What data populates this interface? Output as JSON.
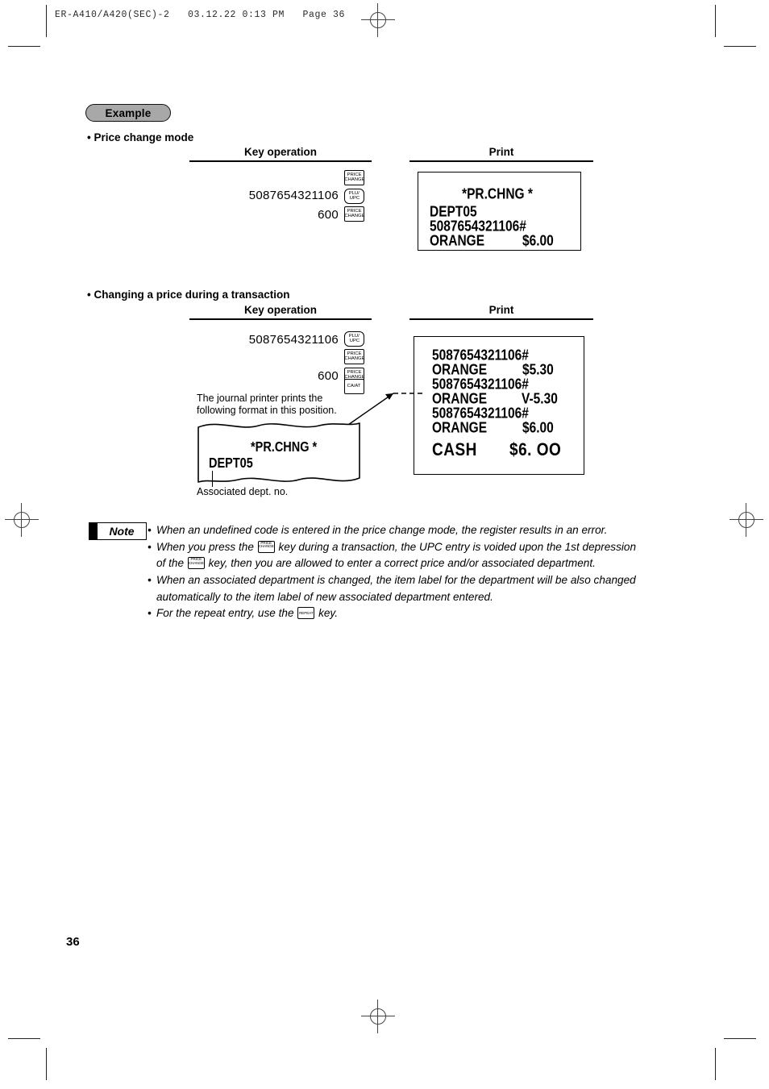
{
  "doc": {
    "header_line": "ER-A410/A420(SEC)-2   03.12.22 0:13 PM   Page 36",
    "page_number": "36"
  },
  "example": {
    "badge_label": "Example"
  },
  "sections": [
    {
      "heading": "• Price change mode",
      "key_operation_title": "Key operation",
      "print_title": "Print",
      "key_rows": [
        {
          "number": "",
          "keys": [
            {
              "lines": [
                "PRICE",
                "CHANGE"
              ],
              "shape": "square",
              "name": "price-change"
            }
          ]
        },
        {
          "number": "5087654321106",
          "keys": [
            {
              "lines": [
                "PLU/",
                "UPC"
              ],
              "shape": "round",
              "name": "plu-upc"
            }
          ]
        },
        {
          "number": "600",
          "keys": [
            {
              "lines": [
                "PRICE",
                "CHANGE"
              ],
              "shape": "square",
              "name": "price-change"
            }
          ]
        }
      ],
      "receipt": {
        "title": "*PR.CHNG *",
        "lines": [
          {
            "label": "DEPT05",
            "amount": ""
          },
          {
            "label": "5087654321106#",
            "amount": ""
          },
          {
            "label": "ORANGE",
            "amount": "$6.00"
          }
        ]
      }
    },
    {
      "heading": "• Changing a price during a transaction",
      "key_operation_title": "Key operation",
      "print_title": "Print",
      "key_rows": [
        {
          "number": "5087654321106",
          "keys": [
            {
              "lines": [
                "PLU/",
                "UPC"
              ],
              "shape": "round",
              "name": "plu-upc"
            }
          ]
        },
        {
          "number": "",
          "keys": [
            {
              "lines": [
                "PRICE",
                "CHANGE"
              ],
              "shape": "square",
              "name": "price-change"
            }
          ]
        },
        {
          "number": "600",
          "keys": [
            {
              "lines": [
                "PRICE",
                "CHANGE"
              ],
              "shape": "square",
              "name": "price-change"
            }
          ]
        },
        {
          "number": "",
          "keys": [
            {
              "lines": [
                "CA/AT"
              ],
              "shape": "square",
              "name": "cash-amount-tender"
            }
          ]
        }
      ],
      "receipt": {
        "lines": [
          {
            "label": "5087654321106#",
            "amount": ""
          },
          {
            "label": "ORANGE",
            "amount": "$5.30"
          },
          {
            "label": "5087654321106#",
            "amount": ""
          },
          {
            "label": "ORANGE",
            "amount": "V-5.30"
          },
          {
            "label": "5087654321106#",
            "amount": ""
          },
          {
            "label": "ORANGE",
            "amount": "$6.00"
          }
        ],
        "total_label": "CASH",
        "total_amount": "$6. OO"
      }
    }
  ],
  "journal": {
    "note_text_line1": "The journal printer prints the",
    "note_text_line2": "following format in this position.",
    "slip_title": "*PR.CHNG *",
    "slip_dept": "DEPT05",
    "caption": "Associated dept. no."
  },
  "note": {
    "badge_label": "Note",
    "items": [
      {
        "parts": [
          {
            "t": "text",
            "v": "When an undefined code is entered in the price change mode, the register results in an error."
          }
        ]
      },
      {
        "parts": [
          {
            "t": "text",
            "v": "When you press the "
          },
          {
            "t": "key",
            "lines": [
              "PRICE",
              "CHANGE"
            ]
          },
          {
            "t": "text",
            "v": " key during a transaction, the UPC entry is voided upon the 1st depression of the "
          },
          {
            "t": "key",
            "lines": [
              "PRICE",
              "CHANGE"
            ]
          },
          {
            "t": "text",
            "v": " key, then you are allowed to enter a correct price and/or associated department."
          }
        ]
      },
      {
        "parts": [
          {
            "t": "text",
            "v": "When an associated department is changed, the item label for the department will be also changed automatically to the item label of new associated department entered."
          }
        ]
      },
      {
        "parts": [
          {
            "t": "text",
            "v": "For the repeat entry, use the "
          },
          {
            "t": "key",
            "lines": [
              "REPEAT"
            ]
          },
          {
            "t": "text",
            "v": " key."
          }
        ]
      }
    ]
  },
  "colors": {
    "badge_fill": "#a8a8a8",
    "ink": "#000000",
    "mark": "#444444"
  }
}
